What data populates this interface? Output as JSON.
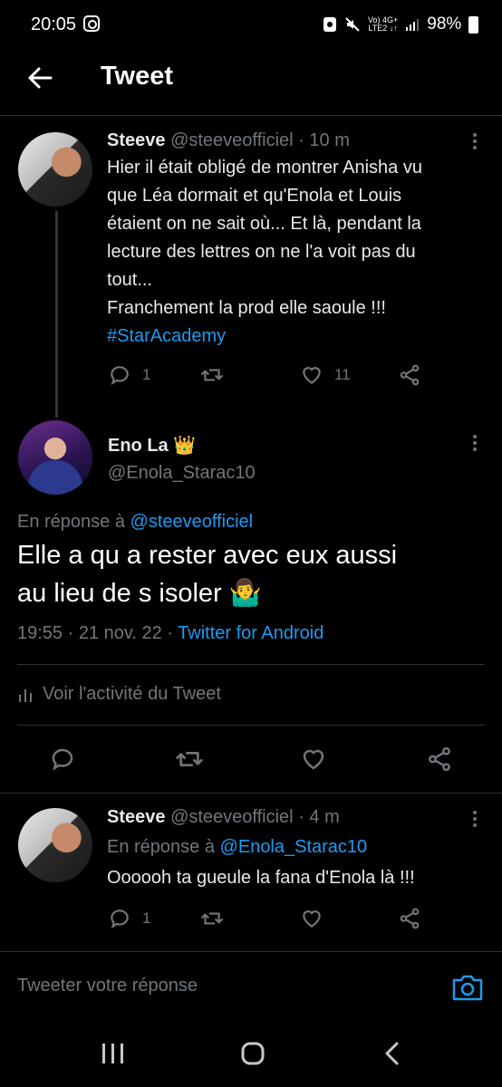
{
  "status_bar": {
    "time": "20:05",
    "network_top": "Vo) 4G+",
    "network_bottom": "LTE2 ↓↑",
    "battery": "98%"
  },
  "header": {
    "title": "Tweet"
  },
  "tweet_parent": {
    "name": "Steeve",
    "handle": "@steeveofficiel",
    "time": "· 10 m",
    "lines": [
      "Hier il était obligé de montrer Anisha vu",
      "que Léa dormait et qu'Enola et Louis",
      "étaient on ne sait où... Et là, pendant la",
      "lecture des lettres on ne l'a voit pas du",
      "tout...",
      "Franchement la prod elle saoule !!!"
    ],
    "hashtag": "#StarAcademy",
    "reply_count": "1",
    "retweet_count": "",
    "like_count": "11"
  },
  "tweet_main": {
    "name": "Eno La",
    "name_emoji": "👑",
    "handle": "@Enola_Starac10",
    "reply_prefix": "En réponse à",
    "reply_to": "@steeveofficiel",
    "text_line1": "Elle a qu a rester avec eux aussi",
    "text_line2": "au lieu de s isoler",
    "text_emoji": "🤷‍♂️",
    "time": "19:55 · 21 nov. 22 ·",
    "source": "Twitter for Android",
    "activity_label": "Voir l'activité du Tweet"
  },
  "tweet_reply": {
    "name": "Steeve",
    "handle": "@steeveofficiel",
    "time": "· 4 m",
    "reply_prefix": "En réponse à",
    "reply_to": "@Enola_Starac10",
    "text": "Oooooh ta gueule la fana d'Enola là !!!",
    "reply_count": "1",
    "retweet_count": "",
    "like_count": ""
  },
  "composer": {
    "placeholder": "Tweeter votre réponse"
  },
  "colors": {
    "background": "#000000",
    "text": "#e7e9ea",
    "muted": "#71767b",
    "link": "#1d9bf0",
    "divider": "#2f3336"
  },
  "icons": [
    "back-arrow-icon",
    "reply-icon",
    "retweet-icon",
    "like-icon",
    "share-icon",
    "more-icon",
    "activity-icon",
    "camera-icon",
    "recent-apps-icon",
    "home-icon",
    "back-nav-icon"
  ]
}
